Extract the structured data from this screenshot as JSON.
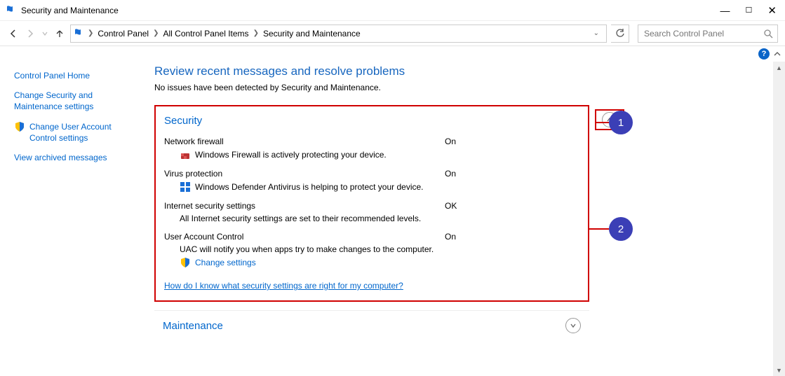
{
  "window": {
    "title": "Security and Maintenance"
  },
  "breadcrumbs": {
    "items": [
      "Control Panel",
      "All Control Panel Items",
      "Security and Maintenance"
    ]
  },
  "search": {
    "placeholder": "Search Control Panel"
  },
  "sidebar": {
    "items": [
      {
        "label": "Control Panel Home"
      },
      {
        "label": "Change Security and Maintenance settings"
      },
      {
        "label": "Change User Account Control settings"
      },
      {
        "label": "View archived messages"
      }
    ]
  },
  "main": {
    "heading": "Review recent messages and resolve problems",
    "sub": "No issues have been detected by Security and Maintenance."
  },
  "security": {
    "title": "Security",
    "rows": [
      {
        "label": "Network firewall",
        "status": "On",
        "detail": "Windows Firewall is actively protecting your device."
      },
      {
        "label": "Virus protection",
        "status": "On",
        "detail": "Windows Defender Antivirus is helping to protect your device."
      },
      {
        "label": "Internet security settings",
        "status": "OK",
        "detail": "All Internet security settings are set to their recommended levels."
      },
      {
        "label": "User Account Control",
        "status": "On",
        "detail": "UAC will notify you when apps try to make changes to the computer."
      }
    ],
    "change_link": "Change settings",
    "help_link": "How do I know what security settings are right for my computer?"
  },
  "maintenance": {
    "title": "Maintenance"
  },
  "callouts": {
    "one": "1",
    "two": "2"
  }
}
